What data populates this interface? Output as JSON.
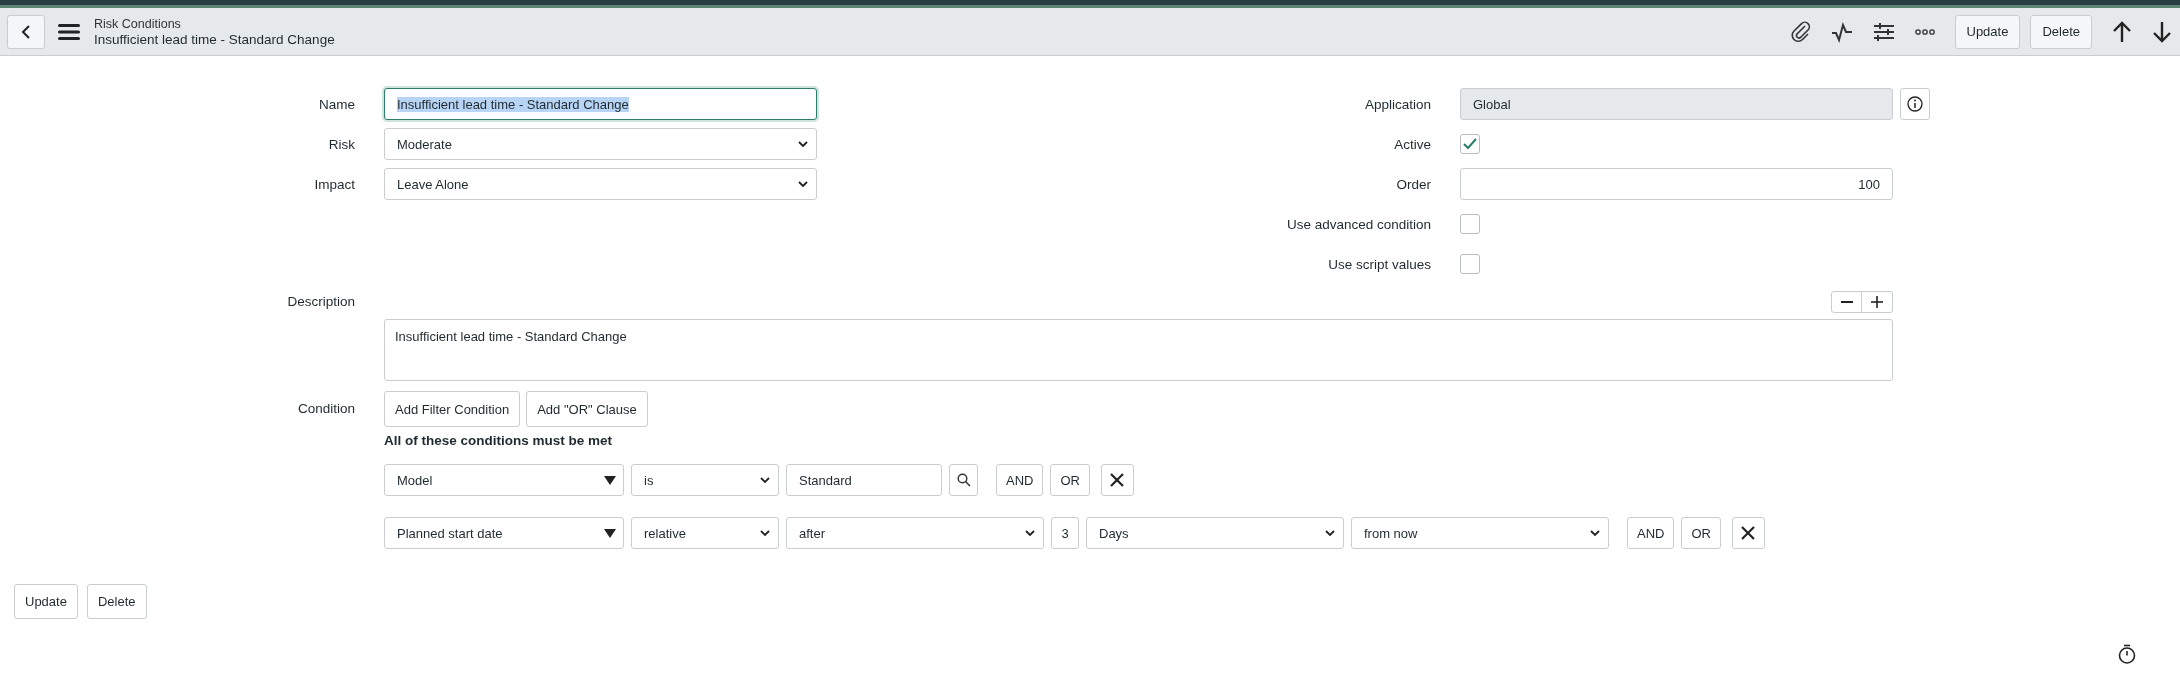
{
  "header": {
    "breadcrumb": "Risk Conditions",
    "title": "Insufficient lead time - Standard Change",
    "buttons": [
      "Update",
      "Delete"
    ]
  },
  "left_fields": [
    {
      "label": "Name",
      "kind": "text",
      "value": "Insufficient lead time - Standard Change",
      "text_selected": true
    },
    {
      "label": "Risk",
      "kind": "select",
      "value": "Moderate"
    },
    {
      "label": "Impact",
      "kind": "select",
      "value": "Leave Alone"
    }
  ],
  "right_fields": [
    {
      "label": "Application",
      "kind": "readonly",
      "value": "Global"
    },
    {
      "label": "Active",
      "kind": "checkbox",
      "checked": true
    },
    {
      "label": "Order",
      "kind": "number",
      "value": "100"
    },
    {
      "label": "Use advanced condition",
      "kind": "checkbox",
      "checked": false
    },
    {
      "label": "Use script values",
      "kind": "checkbox",
      "checked": false
    }
  ],
  "description": {
    "label": "Description",
    "value": "Insufficient lead time - Standard Change"
  },
  "condition": {
    "label": "Condition",
    "buttons": [
      "Add Filter Condition",
      "Add \"OR\" Clause"
    ],
    "heading": "All of these conditions must be met",
    "rows": [
      {
        "field": "Model",
        "operator": "is",
        "parts": [
          {
            "kind": "text",
            "value": "Standard"
          },
          {
            "kind": "lookup"
          }
        ],
        "buttons": [
          "AND",
          "OR"
        ]
      },
      {
        "field": "Planned start date",
        "operator": "relative",
        "parts": [
          {
            "kind": "select",
            "value": "after"
          },
          {
            "kind": "number",
            "value": "3"
          },
          {
            "kind": "select",
            "value": "Days"
          },
          {
            "kind": "select",
            "value": "from now"
          }
        ],
        "buttons": [
          "AND",
          "OR"
        ]
      }
    ]
  },
  "footer_buttons": [
    "Update",
    "Delete"
  ]
}
